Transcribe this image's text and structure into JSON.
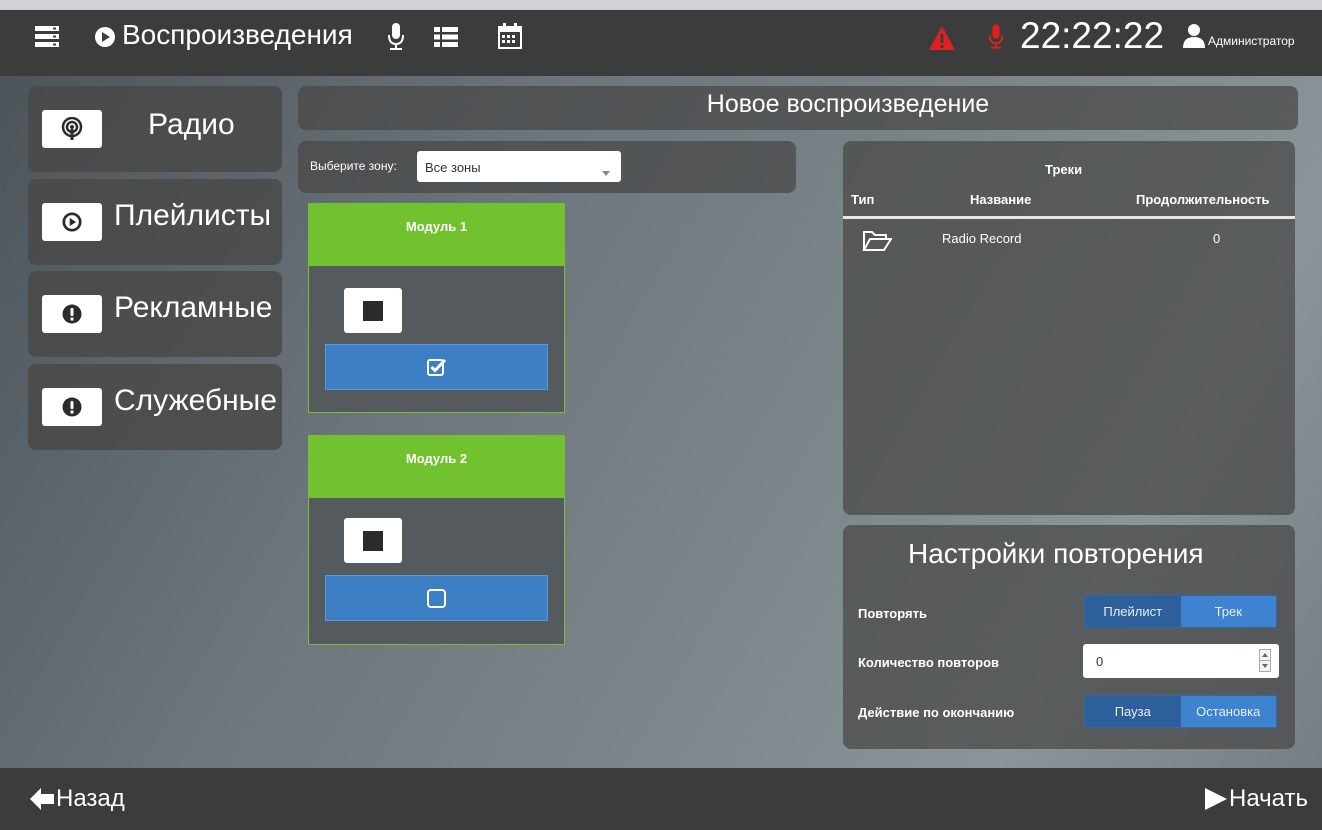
{
  "header": {
    "title": "Воспроизведения",
    "time": "22:22:22",
    "user": "Администратор"
  },
  "sidebar": {
    "items": [
      {
        "label": "Радио",
        "icon": "podcast-icon"
      },
      {
        "label": "Плейлисты",
        "icon": "play-circle-icon"
      },
      {
        "label": "Рекламные",
        "icon": "exclamation-icon"
      },
      {
        "label": "Служебные",
        "icon": "exclamation-icon"
      }
    ]
  },
  "main": {
    "title": "Новое воспроизведение",
    "zone_label": "Выберите зону:",
    "zone_value": "Все зоны",
    "modules": [
      {
        "title": "Модуль 1",
        "checked": true
      },
      {
        "title": "Модуль 2",
        "checked": false
      }
    ]
  },
  "tracks": {
    "title": "Треки",
    "columns": [
      "Тип",
      "Название",
      "Продолжительность"
    ],
    "rows": [
      {
        "type_icon": "folder-open-icon",
        "name": "Radio Record",
        "duration": "0"
      }
    ]
  },
  "repeat": {
    "title": "Настройки повторения",
    "repeat_label": "Повторять",
    "repeat_options": [
      "Плейлист",
      "Трек"
    ],
    "count_label": "Количество повторов",
    "count_value": "0",
    "end_label": "Действие по окончанию",
    "end_options": [
      "Пауза",
      "Остановка"
    ]
  },
  "footer": {
    "back": "Назад",
    "start": "Начать"
  },
  "colors": {
    "topbar": "#3c3c3c",
    "module_green": "#72c12e",
    "button_blue": "#3d7fc4",
    "alert_red": "#e02020"
  }
}
